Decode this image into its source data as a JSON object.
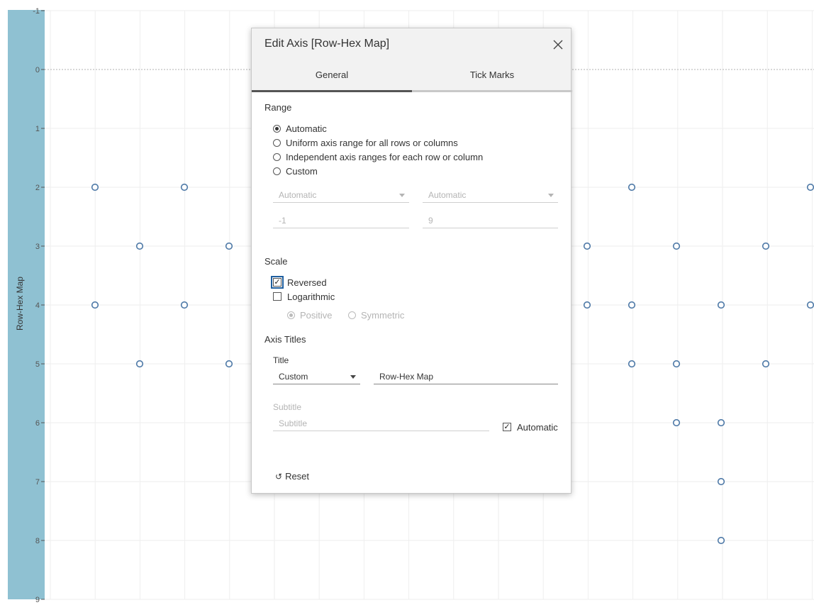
{
  "axis": {
    "title": "Row-Hex Map",
    "ticks": [
      "-1",
      "0",
      "1",
      "2",
      "3",
      "4",
      "5",
      "6",
      "7",
      "8",
      "9"
    ]
  },
  "chart_data": {
    "type": "scatter",
    "ylabel": "Row-Hex Map",
    "ylim": [
      -1,
      9
    ],
    "y_reversed": true,
    "marker": "open-circle",
    "marker_color": "#4e79a7",
    "points_visible_y": [
      2,
      2,
      3,
      3,
      4,
      4,
      5,
      5,
      2,
      2,
      3,
      3,
      3,
      4,
      4,
      4,
      4,
      5,
      5,
      5,
      6,
      6,
      7,
      8
    ]
  },
  "dialog": {
    "title": "Edit Axis [Row-Hex Map]",
    "close_icon": "close-icon",
    "tabs": {
      "general": "General",
      "tick_marks": "Tick Marks"
    },
    "range": {
      "label": "Range",
      "options": [
        "Automatic",
        "Uniform axis range for all rows or columns",
        "Independent axis ranges for each row or column",
        "Custom"
      ],
      "selected": "Automatic",
      "start_mode": "Automatic",
      "end_mode": "Automatic",
      "start_value": "-1",
      "end_value": "9"
    },
    "scale": {
      "label": "Scale",
      "reversed_label": "Reversed",
      "reversed": true,
      "logarithmic_label": "Logarithmic",
      "logarithmic": false,
      "positive_label": "Positive",
      "symmetric_label": "Symmetric"
    },
    "axis_titles": {
      "label": "Axis Titles",
      "title_label": "Title",
      "title_mode": "Custom",
      "title_value": "Row-Hex Map",
      "subtitle_label": "Subtitle",
      "subtitle_placeholder": "Subtitle",
      "subtitle_automatic_label": "Automatic",
      "subtitle_automatic": true
    },
    "reset_label": "Reset"
  },
  "colors": {
    "axis_band": "#8fc1d2",
    "marker": "#4e79a7"
  }
}
